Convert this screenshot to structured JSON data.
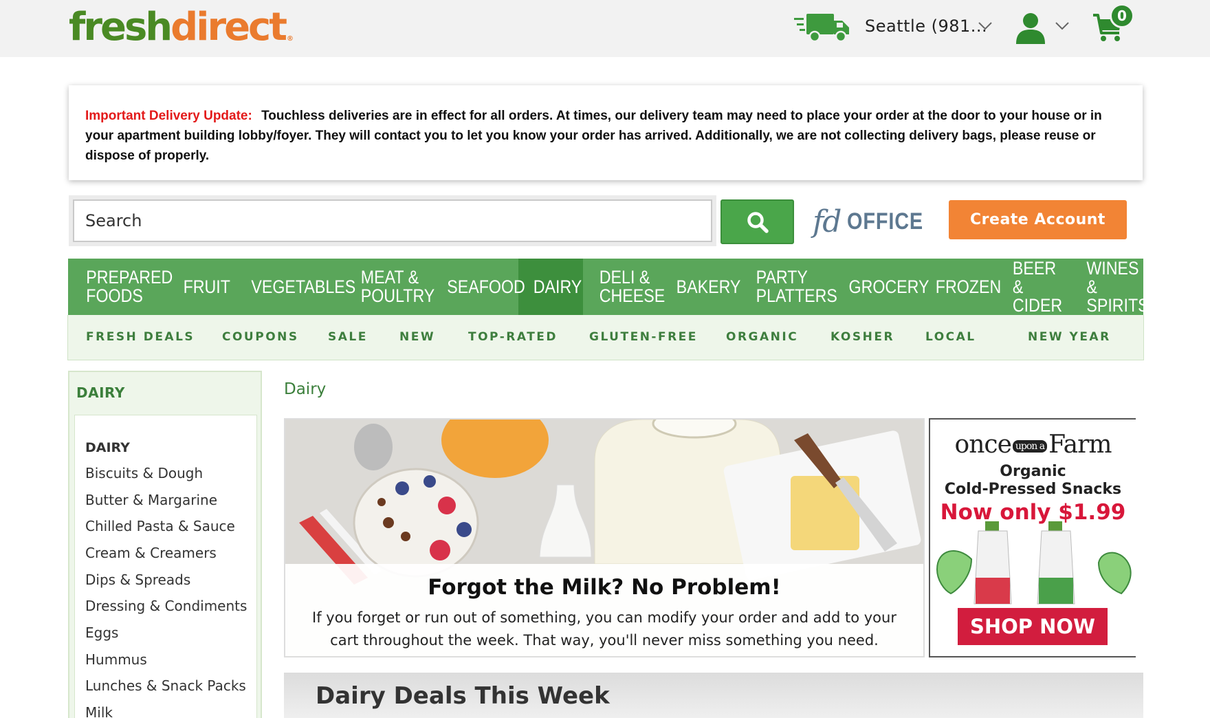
{
  "header": {
    "logo_fresh": "fresh",
    "logo_direct": "direct",
    "logo_reg": "®",
    "zip_label": "Seattle (981...",
    "cart_count": "0"
  },
  "alert": {
    "label": "Important Delivery Update:",
    "text": "Touchless deliveries are in effect for all orders. At times, our delivery team may need to place your order at the door to your house or in your apartment building lobby/foyer. They will contact you to let you know your order has arrived. Additionally, we are not collecting delivery bags, please reuse or dispose of properly."
  },
  "search": {
    "placeholder": "Search"
  },
  "fd_office": {
    "fd": "fd",
    "office": "OFFICE"
  },
  "create_account": "Create Account",
  "main_nav": [
    {
      "label": "PREPARED\nFOODS"
    },
    {
      "label": "FRUIT"
    },
    {
      "label": "VEGETABLES"
    },
    {
      "label": "MEAT &\nPOULTRY"
    },
    {
      "label": "SEAFOOD"
    },
    {
      "label": "DAIRY",
      "active": true
    },
    {
      "label": "DELI &\nCHEESE"
    },
    {
      "label": "BAKERY"
    },
    {
      "label": "PARTY\nPLATTERS"
    },
    {
      "label": "GROCERY"
    },
    {
      "label": "FROZEN"
    },
    {
      "label": "BEER &\nCIDER"
    },
    {
      "label": "WINES &\nSPIRITS"
    }
  ],
  "sub_nav": [
    "FRESH DEALS",
    "COUPONS",
    "SALE",
    "NEW",
    "TOP-RATED",
    "GLUTEN-FREE",
    "ORGANIC",
    "KOSHER",
    "LOCAL",
    "NEW YEAR"
  ],
  "sidebar": {
    "heading": "DAIRY",
    "category": "DAIRY",
    "items": [
      "Biscuits & Dough",
      "Butter & Margarine",
      "Chilled Pasta & Sauce",
      "Cream & Creamers",
      "Dips & Spreads",
      "Dressing & Condiments",
      "Eggs",
      "Hummus",
      "Lunches & Snack Packs",
      "Milk"
    ]
  },
  "breadcrumb": "Dairy",
  "hero": {
    "title": "Forgot the Milk? No Problem!",
    "body": "If you forget or run out of something, you can modify your order and add to your cart throughout the week. That way, you'll never miss something you need."
  },
  "promo": {
    "brand_left": "once",
    "brand_mid": "upon a",
    "brand_right": "Farm",
    "line1": "Organic",
    "line2": "Cold-Pressed Snacks",
    "line3": "Now only $1.99",
    "cta": "SHOP NOW"
  },
  "deals": {
    "title": "Dairy Deals This Week"
  },
  "colors": {
    "brand_green": "#5aa65a",
    "active_green": "#3d8f3d",
    "accent_orange": "#f28435",
    "alert_red": "#e31a1a"
  }
}
